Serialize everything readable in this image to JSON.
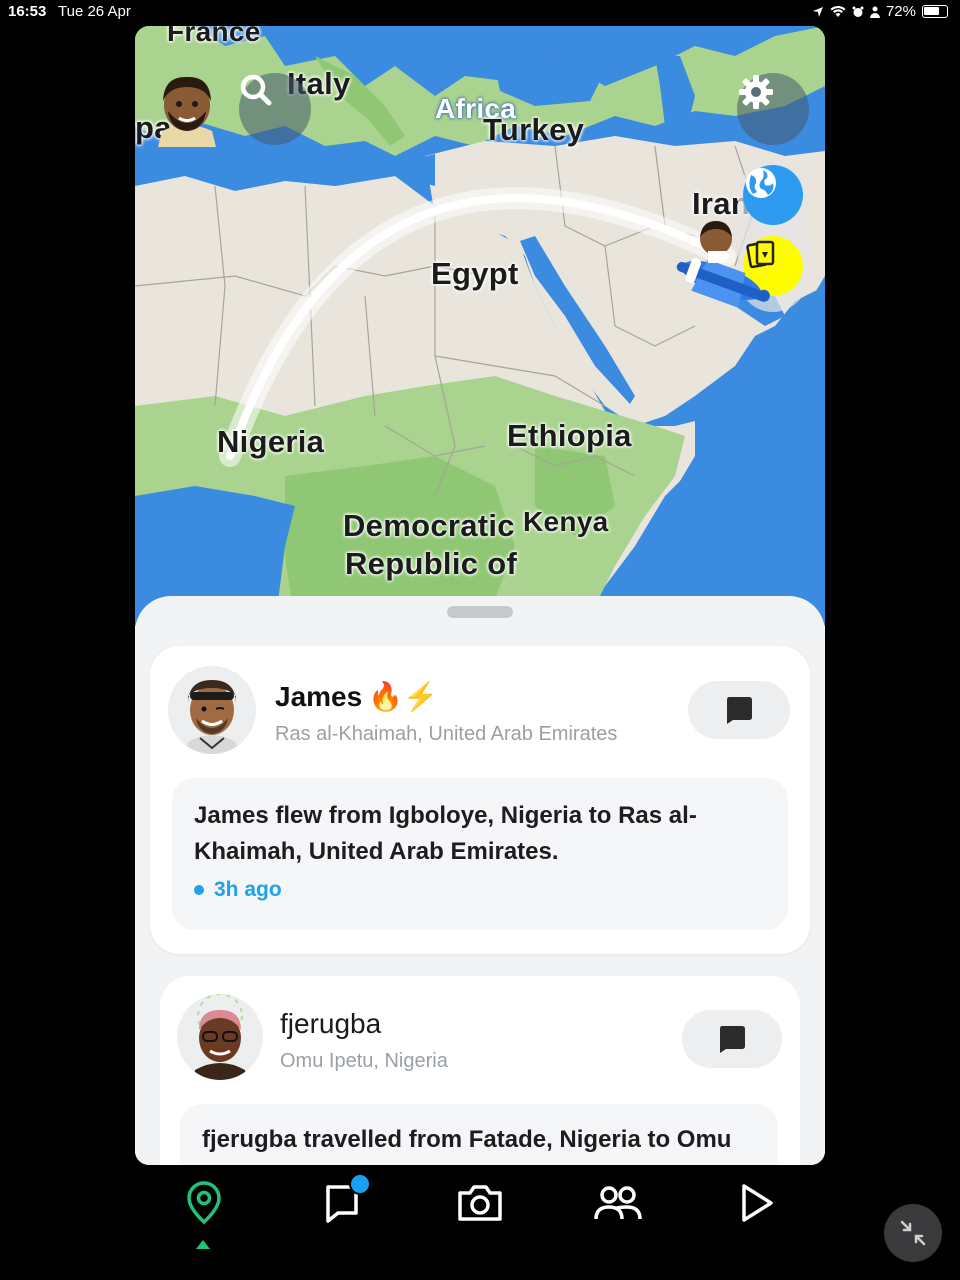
{
  "status_bar": {
    "time": "16:53",
    "date": "Tue 26 Apr",
    "battery": "72%"
  },
  "map": {
    "labels": {
      "france": "France",
      "italy": "Italy",
      "spain_partial": "pai",
      "africa": "Africa",
      "turkey": "Turkey",
      "iran": "Iran",
      "egypt": "Egypt",
      "nigeria": "Nigeria",
      "ethiopia": "Ethiopia",
      "drc_line1": "Democratic",
      "drc_line2": "Republic of",
      "kenya": "Kenya"
    },
    "colors": {
      "ocean": "#3b8be0",
      "land": "#e9e5dc",
      "green": "#a9d38e",
      "flight_arc": "#ffffff"
    }
  },
  "friends": [
    {
      "name": "James",
      "emoji": "🔥⚡",
      "location": "Ras al-Khaimah, United Arab Emirates",
      "story": "James flew from Igboloye, Nigeria to Ras al-Khaimah, United Arab Emirates.",
      "time": "3h ago"
    },
    {
      "name": "fjerugba",
      "location": "Omu Ipetu, Nigeria",
      "story": "fjerugba travelled from Fatade, Nigeria to Omu"
    }
  ],
  "nav": {
    "active": "map",
    "accent": "#1fc47a",
    "badge_color": "#1a9ff2"
  }
}
